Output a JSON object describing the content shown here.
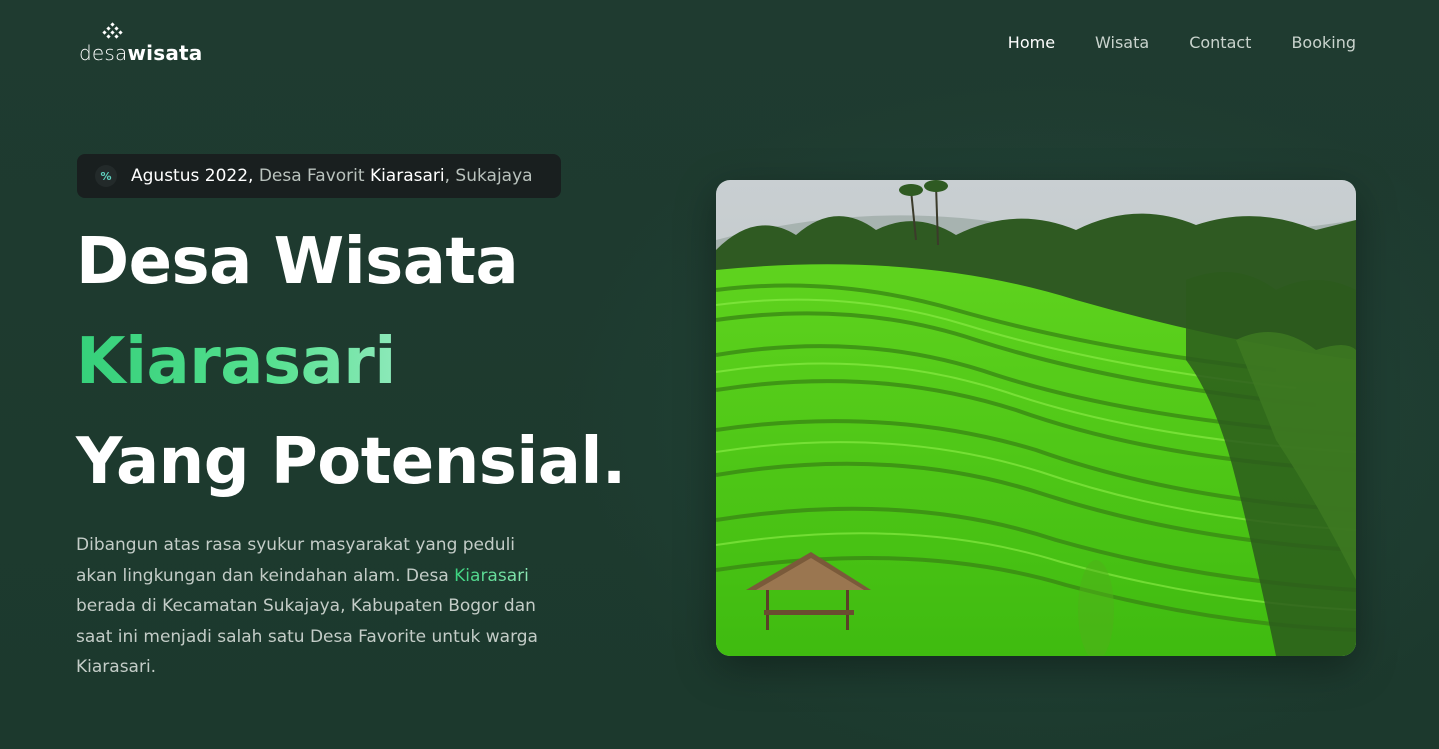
{
  "header": {
    "logo": {
      "part1": "desa",
      "part2": "wisata"
    },
    "nav": [
      {
        "label": "Home",
        "active": true
      },
      {
        "label": "Wisata",
        "active": false
      },
      {
        "label": "Contact",
        "active": false
      },
      {
        "label": "Booking",
        "active": false
      }
    ]
  },
  "hero": {
    "badge": {
      "icon": "percent-icon",
      "date": "Agustus 2022,",
      "middle": " Desa Favorit ",
      "village": "Kiarasari",
      "end": ", Sukajaya"
    },
    "title": {
      "line1": "Desa Wisata",
      "line2": "Kiarasari",
      "line3": "Yang Potensial."
    },
    "description": {
      "part1": "Dibangun atas rasa syukur masyarakat yang peduli akan lingkungan dan keindahan alam. Desa ",
      "keyword": "Kiarasari",
      "part2": " berada di Kecamatan Sukajaya, Kabupaten Bogor dan saat ini menjadi salah satu Desa Favorite untuk warga Kiarasari."
    },
    "image": {
      "subject": "rice-terraces-photo"
    }
  },
  "colors": {
    "background": "#1d3a2e",
    "accent_green": "#35d07a",
    "badge_bg": "#191f1f",
    "text_white": "#ffffff",
    "text_muted": "#c3ccc7"
  }
}
